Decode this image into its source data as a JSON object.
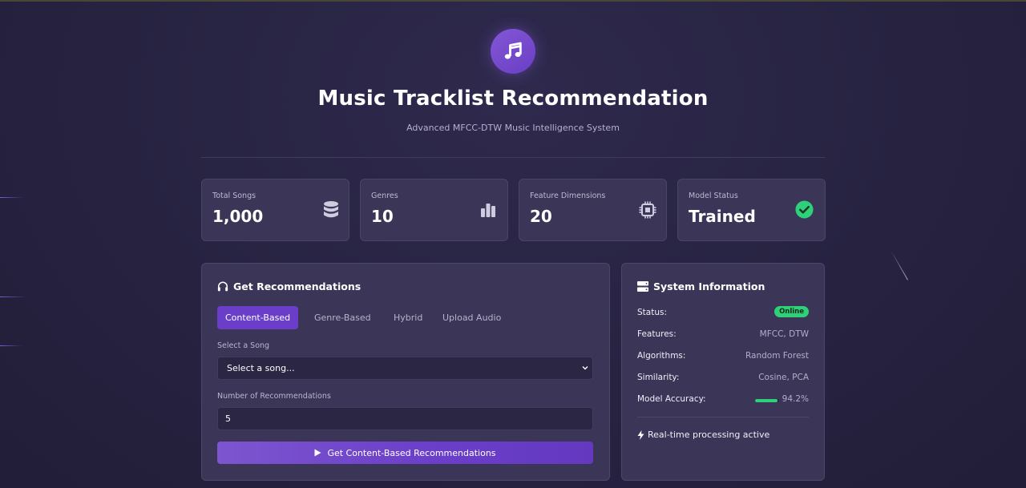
{
  "header": {
    "title": "Music Tracklist Recommendation",
    "subtitle": "Advanced MFCC-DTW Music Intelligence System",
    "logo_icon": "music-note-icon"
  },
  "stats": [
    {
      "label": "Total Songs",
      "value": "1,000",
      "icon": "database-icon"
    },
    {
      "label": "Genres",
      "value": "10",
      "icon": "bar-chart-icon"
    },
    {
      "label": "Feature Dimensions",
      "value": "20",
      "icon": "microchip-icon"
    },
    {
      "label": "Model Status",
      "value": "Trained",
      "icon": "check-circle-icon"
    }
  ],
  "recommend": {
    "title": "Get Recommendations",
    "tabs": [
      "Content-Based",
      "Genre-Based",
      "Hybrid",
      "Upload Audio"
    ],
    "active_tab": "Content-Based",
    "song_label": "Select a Song",
    "song_value": "Select a song...",
    "num_label": "Number of Recommendations",
    "num_value": "5",
    "button_label": "Get Content-Based Recommendations"
  },
  "system": {
    "title": "System Information",
    "status_key": "Status:",
    "status_value": "Online",
    "features_key": "Features:",
    "features_value": "MFCC, DTW",
    "algorithms_key": "Algorithms:",
    "algorithms_value": "Random Forest",
    "similarity_key": "Similarity:",
    "similarity_value": "Cosine, PCA",
    "accuracy_key": "Model Accuracy:",
    "accuracy_value": "94.2%",
    "accuracy_fraction": 0.942,
    "realtime": "Real-time processing active"
  },
  "colors": {
    "accent": "#6a3ec9",
    "success": "#2fd07a",
    "background": "#262240",
    "card": "#3b3657"
  }
}
